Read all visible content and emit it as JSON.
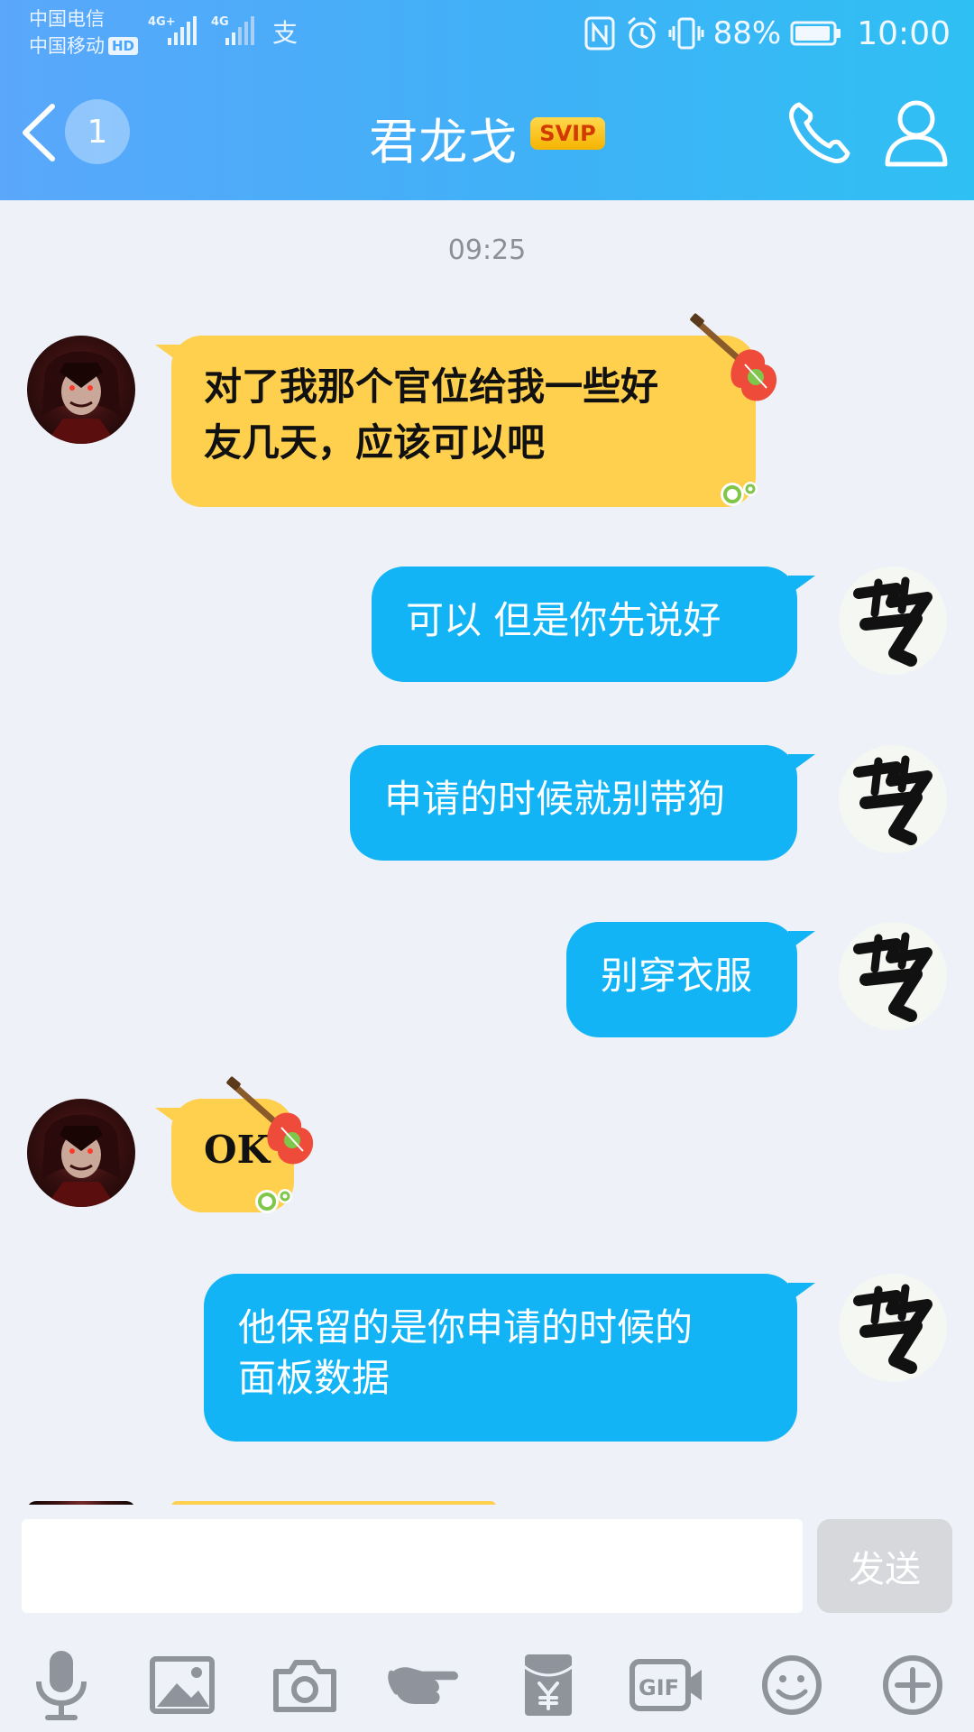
{
  "status_bar": {
    "carrier_1": "中国电信",
    "carrier_2": "中国移动",
    "hd_badge": "HD",
    "battery_percent": "88%",
    "time": "10:00"
  },
  "header": {
    "unread_count": "1",
    "contact_name": "君龙戈",
    "vip_badge": "SVIP"
  },
  "chat": {
    "timestamp": "09:25",
    "messages": [
      {
        "sender": "other",
        "text_line1": "对了我那个官位给我一些好",
        "text_line2": "友几天，应该可以吧"
      },
      {
        "sender": "self",
        "text": "可以  但是你先说好"
      },
      {
        "sender": "self",
        "text": "申请的时候就别带狗"
      },
      {
        "sender": "self",
        "text": "别穿衣服"
      },
      {
        "sender": "other",
        "text": "OK"
      },
      {
        "sender": "self",
        "text_line1": "他保留的是你申请的时候的",
        "text_line2": "面板数据"
      }
    ]
  },
  "input": {
    "value": "",
    "send_label": "发送"
  },
  "toolbar": {
    "items": [
      "microphone-icon",
      "image-icon",
      "camera-icon",
      "poke-icon",
      "red-packet-icon",
      "gif-icon",
      "emoji-icon",
      "plus-icon"
    ]
  },
  "colors": {
    "header_start": "#5aa7fb",
    "header_end": "#2fc0f3",
    "self_bubble": "#12b4f5",
    "other_bubble": "#ffd04d",
    "background": "#eef1f7"
  }
}
